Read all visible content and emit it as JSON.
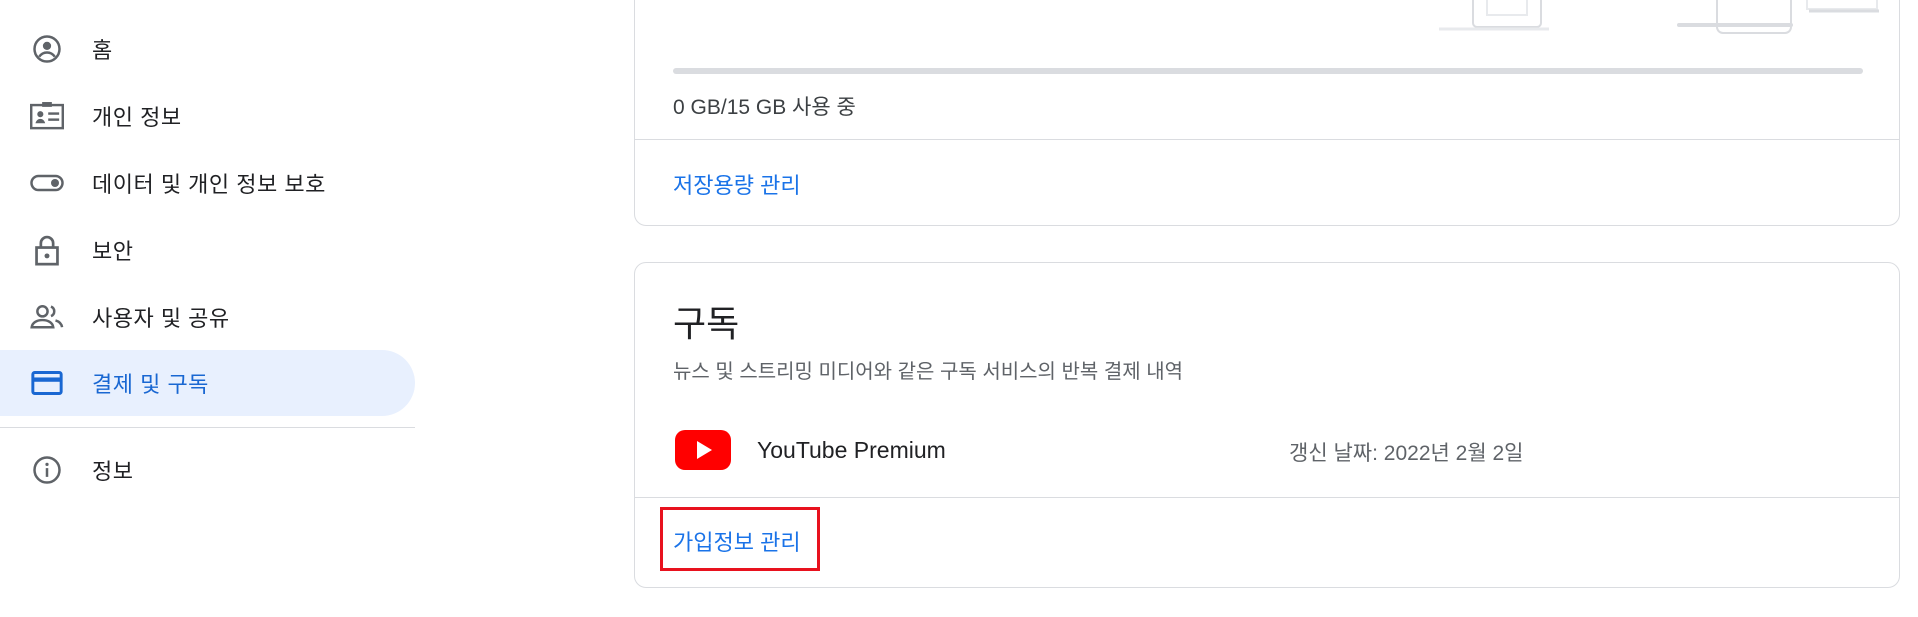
{
  "sidebar": {
    "items": [
      {
        "label": "홈",
        "icon": "account-circle-icon"
      },
      {
        "label": "개인 정보",
        "icon": "id-card-icon"
      },
      {
        "label": "데이터 및 개인 정보 보호",
        "icon": "toggle-icon"
      },
      {
        "label": "보안",
        "icon": "lock-icon"
      },
      {
        "label": "사용자 및 공유",
        "icon": "people-icon"
      },
      {
        "label": "결제 및 구독",
        "icon": "credit-card-icon",
        "active": true
      },
      {
        "label": "정보",
        "icon": "info-icon"
      }
    ]
  },
  "storage": {
    "usage_text": "0 GB/15 GB 사용 중",
    "used_fraction": 0.0,
    "manage_link": "저장용량 관리"
  },
  "subscriptions": {
    "title": "구독",
    "description": "뉴스 및 스트리밍 미디어와 같은 구독 서비스의 반복 결제 내역",
    "items": [
      {
        "name": "YouTube Premium",
        "renewal": "갱신 날짜: 2022년 2월 2일",
        "icon": "youtube-icon"
      }
    ],
    "manage_link": "가입정보 관리"
  },
  "colors": {
    "accent": "#1a73e8",
    "active_bg": "#e8f0fe",
    "active_text": "#1967d2",
    "highlight": "#e8121e",
    "youtube_red": "#ff0000"
  }
}
